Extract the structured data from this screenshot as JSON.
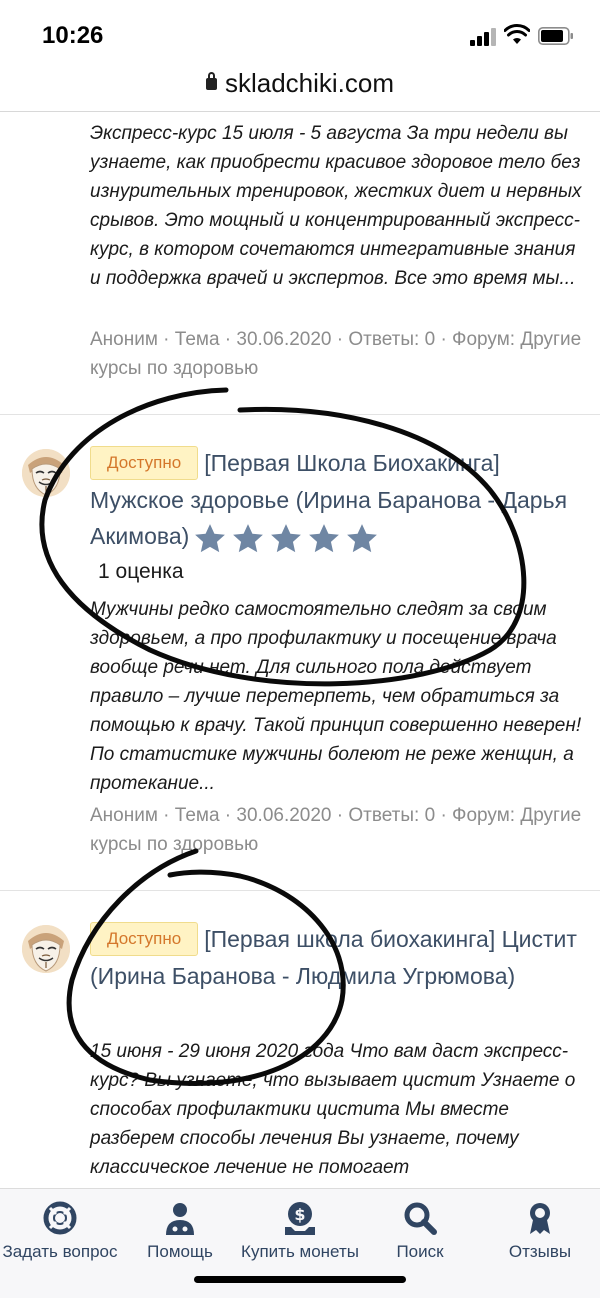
{
  "status": {
    "time": "10:26"
  },
  "browser": {
    "url": "skladchiki.com"
  },
  "threads": [
    {
      "snippet": "Экспресс-курс 15 июля - 5 августа За три недели вы узнаете, как приобрести красивое здоровое тело без изнурительных тренировок, жестких диет и нервных срывов. Это мощный и концентрированный экспресс-курс, в котором сочетаются интегративные знания и поддержка врачей и экспертов. Все это время мы...",
      "meta": "Аноним · Тема · 30.06.2020 · Ответы: 0 · Форум: Другие курсы по здоровью"
    },
    {
      "badge": "Доступно",
      "title": "[Первая Школа Биохакинга] Мужское здоровье (Ирина Баранова - Дарья Акимова)",
      "stars": 5,
      "rating_count": "1 оценка",
      "snippet": "Мужчины редко самостоятельно следят за своим здоровьем, а про профилактику и посещение врача вообще речи нет. Для сильного пола действует правило – лучше перетерпеть, чем обратиться за помощью к врачу. Такой принцип совершенно неверен! По статистике мужчины болеют не реже женщин, а протекание...",
      "meta": "Аноним · Тема · 30.06.2020 · Ответы: 0 · Форум: Другие курсы по здоровью"
    },
    {
      "badge": "Доступно",
      "title": "[Первая школа биохакинга] Цистит (Ирина Баранова - Людмила Угрюмова)",
      "snippet": "15 июня - 29 июня 2020 года Что вам даст экспресс-курс? Вы узнаете, что вызывает цистит Узнаете о способах профилактики цистита Мы вместе разберем способы лечения Вы узнаете, почему классическое лечение не помогает"
    }
  ],
  "nav": {
    "items": [
      {
        "label": "Задать вопрос",
        "icon": "lifebuoy-icon"
      },
      {
        "label": "Помощь",
        "icon": "doctor-icon"
      },
      {
        "label": "Купить монеты",
        "icon": "coins-icon"
      },
      {
        "label": "Поиск",
        "icon": "search-icon"
      },
      {
        "label": "Отзывы",
        "icon": "award-icon"
      }
    ]
  },
  "colors": {
    "badge_bg": "#fff3c4",
    "badge_text": "#d4772b",
    "title": "#3d4f66",
    "star": "#6f86a3",
    "nav_icon": "#304562",
    "meta": "#8c8c8c"
  }
}
